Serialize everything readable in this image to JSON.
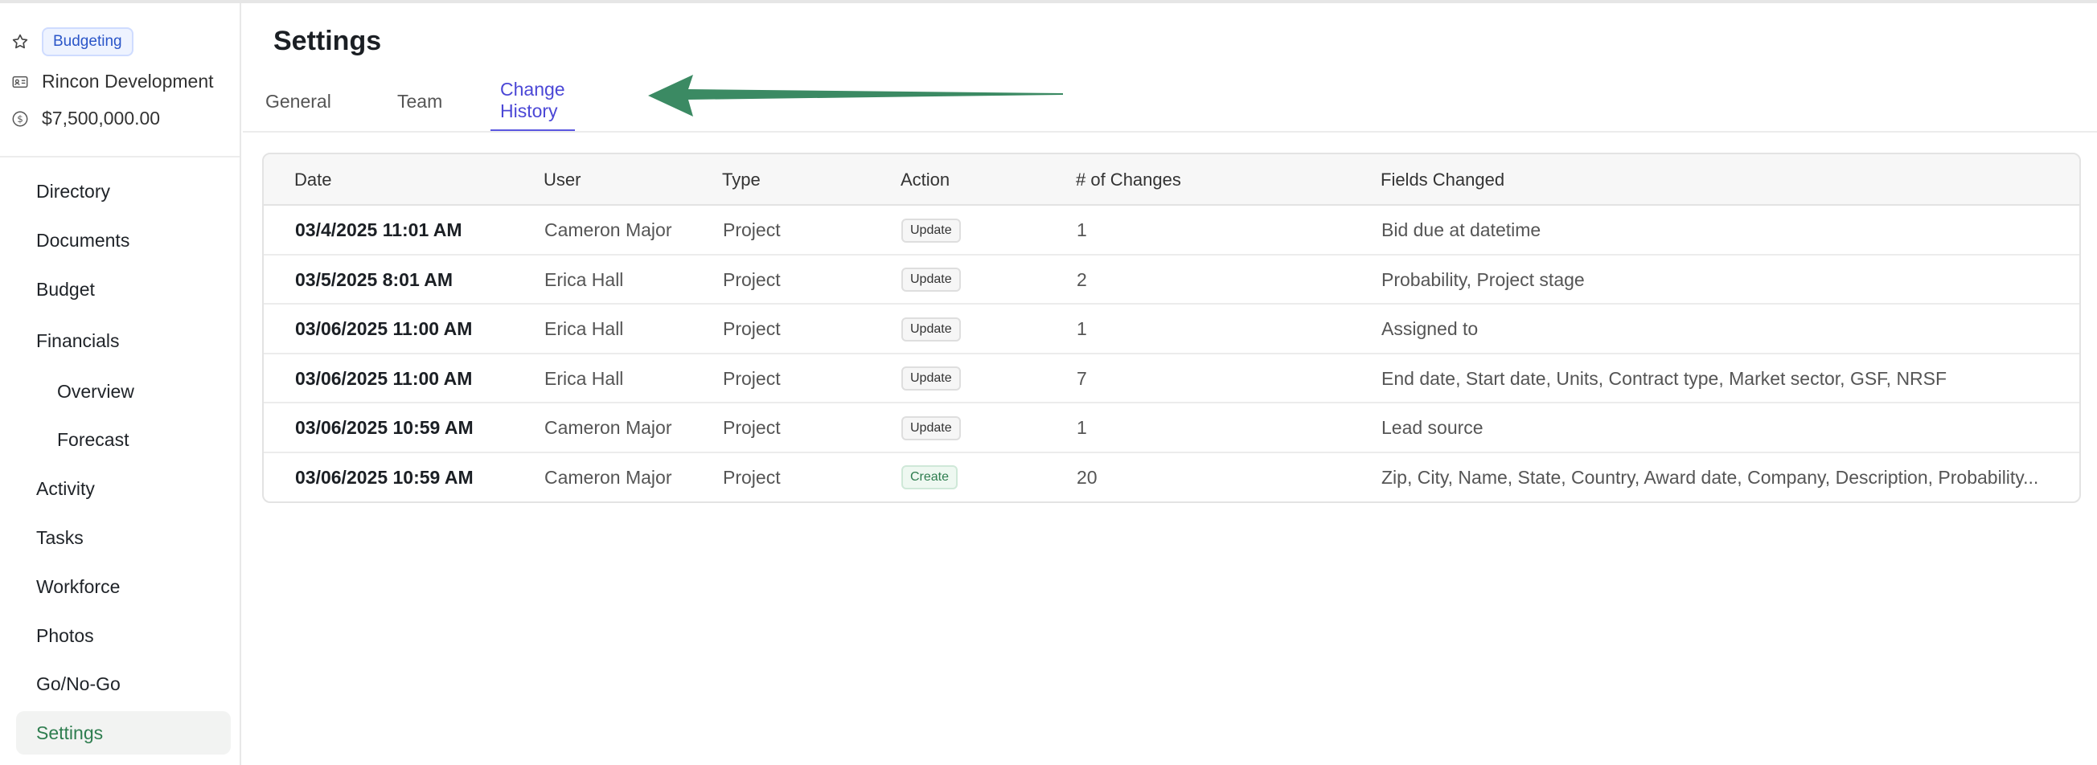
{
  "project": {
    "badge": "Budgeting",
    "client": "Rincon Development",
    "amount": "$7,500,000.00"
  },
  "icons": {
    "favorite": "star-icon",
    "client": "id-card-icon",
    "amount": "dollar-circle-icon"
  },
  "nav": [
    {
      "label": "Directory"
    },
    {
      "label": "Documents"
    },
    {
      "label": "Budget"
    },
    {
      "label": "Financials"
    },
    {
      "label": "Overview"
    },
    {
      "label": "Forecast"
    },
    {
      "label": "Activity"
    },
    {
      "label": "Tasks"
    },
    {
      "label": "Workforce"
    },
    {
      "label": "Photos"
    },
    {
      "label": "Go/No-Go"
    },
    {
      "label": "Settings"
    }
  ],
  "page": {
    "title": "Settings"
  },
  "tabs": [
    {
      "label": "General"
    },
    {
      "label": "Team"
    },
    {
      "label": "Change History"
    }
  ],
  "table": {
    "headers": [
      "Date",
      "User",
      "Type",
      "Action",
      "# of Changes",
      "Fields Changed"
    ],
    "rows": [
      {
        "date": "03/4/2025 11:01 AM",
        "user": "Cameron Major",
        "type": "Project",
        "action": "Update",
        "changes": "1",
        "fields": "Bid due at datetime"
      },
      {
        "date": "03/5/2025 8:01 AM",
        "user": "Erica Hall",
        "type": "Project",
        "action": "Update",
        "changes": "2",
        "fields": "Probability, Project stage"
      },
      {
        "date": "03/06/2025 11:00 AM",
        "user": "Erica Hall",
        "type": "Project",
        "action": "Update",
        "changes": "1",
        "fields": "Assigned to"
      },
      {
        "date": "03/06/2025 11:00 AM",
        "user": "Erica Hall",
        "type": "Project",
        "action": "Update",
        "changes": "7",
        "fields": "End date, Start date, Units, Contract type, Market sector, GSF, NRSF"
      },
      {
        "date": "03/06/2025 10:59 AM",
        "user": "Cameron Major",
        "type": "Project",
        "action": "Update",
        "changes": "1",
        "fields": "Lead source"
      },
      {
        "date": "03/06/2025 10:59 AM",
        "user": "Cameron Major",
        "type": "Project",
        "action": "Create",
        "changes": "20",
        "fields": "Zip, City, Name, State, Country, Award date, Company, Description, Probability..."
      }
    ]
  },
  "colors": {
    "accent": "#4b47d6",
    "active_nav": "#2e7d4f",
    "arrow": "#3b8a63"
  }
}
